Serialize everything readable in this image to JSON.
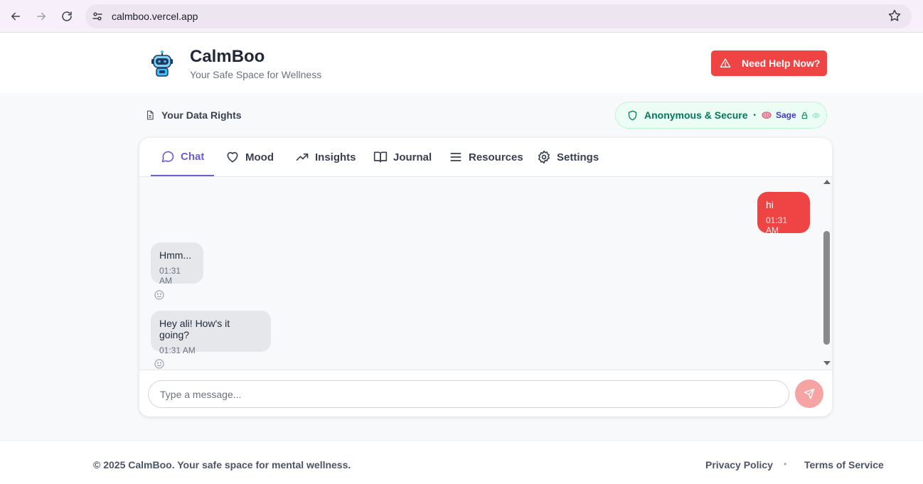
{
  "browser": {
    "url": "calmboo.vercel.app",
    "icons": [
      "back-arrow-icon",
      "forward-arrow-icon",
      "reload-icon",
      "site-settings-icon",
      "bookmark-star-icon"
    ]
  },
  "header": {
    "title": "CalmBoo",
    "subtitle": "Your Safe Space for Wellness",
    "help_label": "Need Help Now?",
    "help_color": "#ef4444"
  },
  "status": {
    "data_rights_label": "Your Data Rights",
    "secure_label": "Anonymous & Secure",
    "separator": "•",
    "persona": "Sage"
  },
  "tabs": [
    {
      "label": "Chat",
      "icon": "chat-bubble-icon",
      "active": true
    },
    {
      "label": "Mood",
      "icon": "heart-icon",
      "active": false
    },
    {
      "label": "Insights",
      "icon": "trending-up-icon",
      "active": false
    },
    {
      "label": "Journal",
      "icon": "book-open-icon",
      "active": false
    },
    {
      "label": "Resources",
      "icon": "menu-lines-icon",
      "active": false
    },
    {
      "label": "Settings",
      "icon": "gear-icon",
      "active": false
    }
  ],
  "messages": [
    {
      "from": "user",
      "text": "hi",
      "time": "01:31 AM"
    },
    {
      "from": "bot",
      "text": "Hmm...",
      "time": "01:31 AM"
    },
    {
      "from": "bot",
      "text": "Hey ali! How's it going?",
      "time": "01:31 AM"
    }
  ],
  "composer": {
    "placeholder": "Type a message...",
    "value": ""
  },
  "footer": {
    "copyright": "© 2025 CalmBoo. Your safe space for mental wellness.",
    "privacy": "Privacy Policy",
    "dot": "•",
    "terms": "Terms of Service"
  },
  "colors": {
    "accent": "#6d5fd3",
    "user_bubble": "#ef4444",
    "bot_bubble": "#e5e7eb",
    "secure_green": "#047857"
  }
}
